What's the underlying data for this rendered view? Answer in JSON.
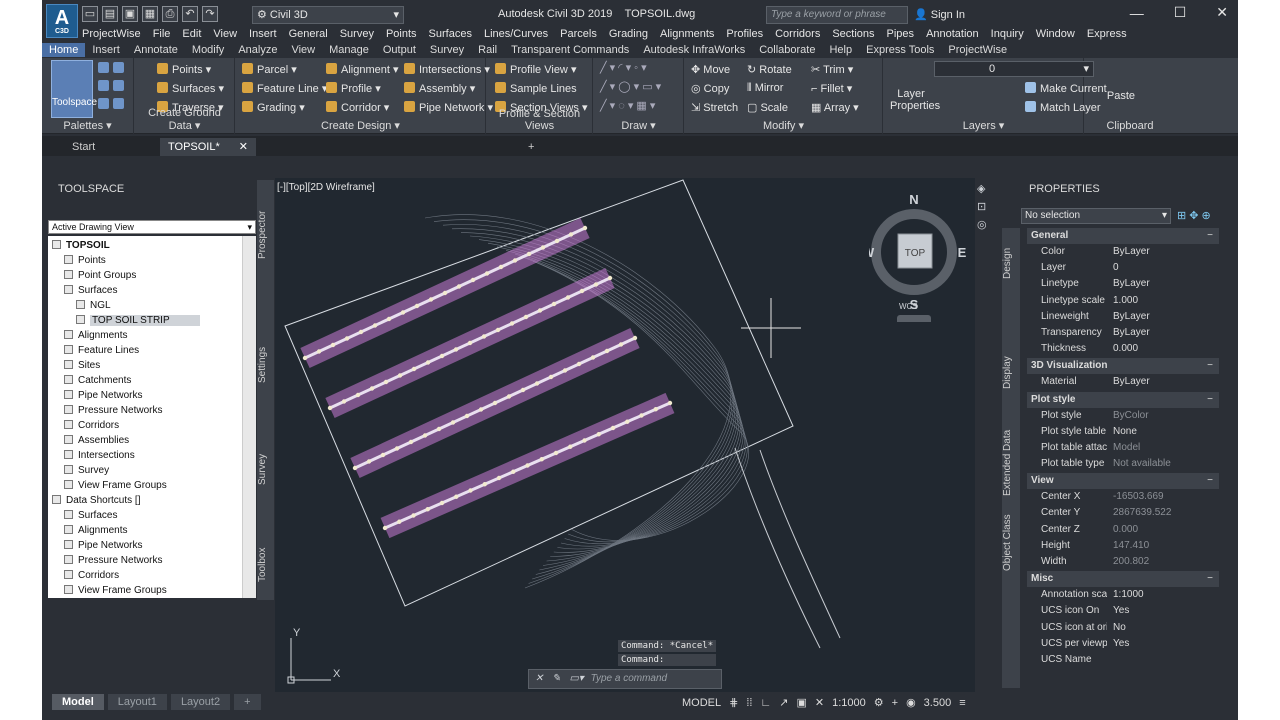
{
  "app": {
    "logo": "A",
    "logo_sub": "C3D",
    "title": "Autodesk Civil 3D 2019",
    "file": "TOPSOIL.dwg",
    "workspace": "Civil 3D",
    "search_placeholder": "Type a keyword or phrase",
    "signin": "Sign In"
  },
  "menu": [
    "ProjectWise",
    "File",
    "Edit",
    "View",
    "Insert",
    "General",
    "Survey",
    "Points",
    "Surfaces",
    "Lines/Curves",
    "Parcels",
    "Grading",
    "Alignments",
    "Profiles",
    "Corridors",
    "Sections",
    "Pipes",
    "Annotation",
    "Inquiry",
    "Window",
    "Express"
  ],
  "tabs": [
    "Home",
    "Insert",
    "Annotate",
    "Modify",
    "Analyze",
    "View",
    "Manage",
    "Output",
    "Survey",
    "Rail",
    "Transparent Commands",
    "Autodesk InfraWorks",
    "Collaborate",
    "Help",
    "Express Tools",
    "ProjectWise"
  ],
  "ribbon": {
    "palettes": {
      "title": "Palettes",
      "toolspace": "Toolspace"
    },
    "ground": {
      "title": "Create Ground Data",
      "items": [
        "Points",
        "Surfaces",
        "Traverse"
      ]
    },
    "design": {
      "title": "Create Design",
      "items": [
        "Parcel",
        "Feature Line",
        "Grading",
        "Alignment",
        "Profile",
        "Corridor",
        "Intersections",
        "Assembly",
        "Pipe Network"
      ]
    },
    "profile_section": {
      "title": "Profile & Section Views",
      "items": [
        "Profile View",
        "Sample Lines",
        "Section Views"
      ]
    },
    "draw": {
      "title": "Draw"
    },
    "modify": {
      "title": "Modify",
      "items": [
        "Move",
        "Rotate",
        "Trim",
        "Copy",
        "Mirror",
        "Fillet",
        "Stretch",
        "Scale",
        "Array"
      ]
    },
    "layers": {
      "title": "Layers",
      "layer_props": "Layer Properties",
      "current_layer": "0",
      "make_current": "Make Current",
      "match_layer": "Match Layer"
    },
    "clipboard": {
      "title": "Clipboard",
      "paste": "Paste"
    }
  },
  "doc_tabs": [
    "Start",
    "TOPSOIL*"
  ],
  "toolspace": {
    "title": "TOOLSPACE",
    "view": "Active Drawing View",
    "tree": [
      {
        "label": "TOPSOIL",
        "level": 0,
        "bold": true
      },
      {
        "label": "Points",
        "level": 1
      },
      {
        "label": "Point Groups",
        "level": 1
      },
      {
        "label": "Surfaces",
        "level": 1
      },
      {
        "label": "NGL",
        "level": 2
      },
      {
        "label": "TOP SOIL STRIP",
        "level": 2,
        "selected": true
      },
      {
        "label": "Alignments",
        "level": 1
      },
      {
        "label": "Feature Lines",
        "level": 1
      },
      {
        "label": "Sites",
        "level": 1
      },
      {
        "label": "Catchments",
        "level": 1
      },
      {
        "label": "Pipe Networks",
        "level": 1
      },
      {
        "label": "Pressure Networks",
        "level": 1
      },
      {
        "label": "Corridors",
        "level": 1
      },
      {
        "label": "Assemblies",
        "level": 1
      },
      {
        "label": "Intersections",
        "level": 1
      },
      {
        "label": "Survey",
        "level": 1
      },
      {
        "label": "View Frame Groups",
        "level": 1
      },
      {
        "label": "Data Shortcuts []",
        "level": 0
      },
      {
        "label": "Surfaces",
        "level": 1
      },
      {
        "label": "Alignments",
        "level": 1
      },
      {
        "label": "Pipe Networks",
        "level": 1
      },
      {
        "label": "Pressure Networks",
        "level": 1
      },
      {
        "label": "Corridors",
        "level": 1
      },
      {
        "label": "View Frame Groups",
        "level": 1
      }
    ],
    "vtabs": [
      "Prospector",
      "Settings",
      "Survey",
      "Toolbox"
    ]
  },
  "viewport": {
    "label": "[-][Top][2D Wireframe]",
    "cube": {
      "n": "N",
      "s": "S",
      "e": "E",
      "w": "W",
      "top": "TOP",
      "wcs": "WCS"
    },
    "axis_y": "Y",
    "axis_x": "X",
    "cmd_history": [
      "Command: *Cancel*",
      "Command:"
    ],
    "cmd_placeholder": "Type a command"
  },
  "properties": {
    "title": "PROPERTIES",
    "selection": "No selection",
    "vtabs": [
      "Design",
      "Display",
      "Extended Data",
      "Object Class"
    ],
    "categories": [
      {
        "name": "General",
        "rows": [
          {
            "k": "Color",
            "v": "ByLayer"
          },
          {
            "k": "Layer",
            "v": "0"
          },
          {
            "k": "Linetype",
            "v": "ByLayer"
          },
          {
            "k": "Linetype scale",
            "v": "1.000"
          },
          {
            "k": "Lineweight",
            "v": "ByLayer"
          },
          {
            "k": "Transparency",
            "v": "ByLayer"
          },
          {
            "k": "Thickness",
            "v": "0.000"
          }
        ]
      },
      {
        "name": "3D Visualization",
        "rows": [
          {
            "k": "Material",
            "v": "ByLayer"
          }
        ]
      },
      {
        "name": "Plot style",
        "rows": [
          {
            "k": "Plot style",
            "v": "ByColor",
            "dim": true
          },
          {
            "k": "Plot style table",
            "v": "None"
          },
          {
            "k": "Plot table attac...",
            "v": "Model",
            "dim": true
          },
          {
            "k": "Plot table type",
            "v": "Not available",
            "dim": true
          }
        ]
      },
      {
        "name": "View",
        "rows": [
          {
            "k": "Center X",
            "v": "-16503.669",
            "dim": true
          },
          {
            "k": "Center Y",
            "v": "2867639.522",
            "dim": true
          },
          {
            "k": "Center Z",
            "v": "0.000",
            "dim": true
          },
          {
            "k": "Height",
            "v": "147.410",
            "dim": true
          },
          {
            "k": "Width",
            "v": "200.802",
            "dim": true
          }
        ]
      },
      {
        "name": "Misc",
        "rows": [
          {
            "k": "Annotation scale",
            "v": "1:1000"
          },
          {
            "k": "UCS icon On",
            "v": "Yes"
          },
          {
            "k": "UCS icon at ori...",
            "v": "No"
          },
          {
            "k": "UCS per viewport",
            "v": "Yes"
          },
          {
            "k": "UCS Name",
            "v": ""
          }
        ]
      }
    ]
  },
  "status": {
    "layouts": [
      "Model",
      "Layout1",
      "Layout2"
    ],
    "model": "MODEL",
    "scale": "1:1000",
    "value": "3.500"
  },
  "colors": {
    "accent": "#4a6fa5",
    "corridor": "#c87ad6",
    "bg": "#212830"
  }
}
